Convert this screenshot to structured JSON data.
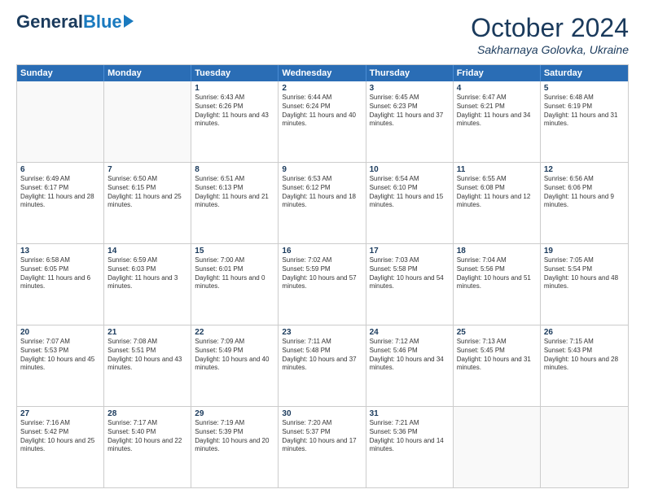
{
  "header": {
    "logo_general": "General",
    "logo_blue": "Blue",
    "month_title": "October 2024",
    "location": "Sakharnaya Golovka, Ukraine"
  },
  "days_of_week": [
    "Sunday",
    "Monday",
    "Tuesday",
    "Wednesday",
    "Thursday",
    "Friday",
    "Saturday"
  ],
  "weeks": [
    [
      {
        "day": "",
        "empty": true
      },
      {
        "day": "",
        "empty": true
      },
      {
        "day": "1",
        "sunrise": "Sunrise: 6:43 AM",
        "sunset": "Sunset: 6:26 PM",
        "daylight": "Daylight: 11 hours and 43 minutes."
      },
      {
        "day": "2",
        "sunrise": "Sunrise: 6:44 AM",
        "sunset": "Sunset: 6:24 PM",
        "daylight": "Daylight: 11 hours and 40 minutes."
      },
      {
        "day": "3",
        "sunrise": "Sunrise: 6:45 AM",
        "sunset": "Sunset: 6:23 PM",
        "daylight": "Daylight: 11 hours and 37 minutes."
      },
      {
        "day": "4",
        "sunrise": "Sunrise: 6:47 AM",
        "sunset": "Sunset: 6:21 PM",
        "daylight": "Daylight: 11 hours and 34 minutes."
      },
      {
        "day": "5",
        "sunrise": "Sunrise: 6:48 AM",
        "sunset": "Sunset: 6:19 PM",
        "daylight": "Daylight: 11 hours and 31 minutes."
      }
    ],
    [
      {
        "day": "6",
        "sunrise": "Sunrise: 6:49 AM",
        "sunset": "Sunset: 6:17 PM",
        "daylight": "Daylight: 11 hours and 28 minutes."
      },
      {
        "day": "7",
        "sunrise": "Sunrise: 6:50 AM",
        "sunset": "Sunset: 6:15 PM",
        "daylight": "Daylight: 11 hours and 25 minutes."
      },
      {
        "day": "8",
        "sunrise": "Sunrise: 6:51 AM",
        "sunset": "Sunset: 6:13 PM",
        "daylight": "Daylight: 11 hours and 21 minutes."
      },
      {
        "day": "9",
        "sunrise": "Sunrise: 6:53 AM",
        "sunset": "Sunset: 6:12 PM",
        "daylight": "Daylight: 11 hours and 18 minutes."
      },
      {
        "day": "10",
        "sunrise": "Sunrise: 6:54 AM",
        "sunset": "Sunset: 6:10 PM",
        "daylight": "Daylight: 11 hours and 15 minutes."
      },
      {
        "day": "11",
        "sunrise": "Sunrise: 6:55 AM",
        "sunset": "Sunset: 6:08 PM",
        "daylight": "Daylight: 11 hours and 12 minutes."
      },
      {
        "day": "12",
        "sunrise": "Sunrise: 6:56 AM",
        "sunset": "Sunset: 6:06 PM",
        "daylight": "Daylight: 11 hours and 9 minutes."
      }
    ],
    [
      {
        "day": "13",
        "sunrise": "Sunrise: 6:58 AM",
        "sunset": "Sunset: 6:05 PM",
        "daylight": "Daylight: 11 hours and 6 minutes."
      },
      {
        "day": "14",
        "sunrise": "Sunrise: 6:59 AM",
        "sunset": "Sunset: 6:03 PM",
        "daylight": "Daylight: 11 hours and 3 minutes."
      },
      {
        "day": "15",
        "sunrise": "Sunrise: 7:00 AM",
        "sunset": "Sunset: 6:01 PM",
        "daylight": "Daylight: 11 hours and 0 minutes."
      },
      {
        "day": "16",
        "sunrise": "Sunrise: 7:02 AM",
        "sunset": "Sunset: 5:59 PM",
        "daylight": "Daylight: 10 hours and 57 minutes."
      },
      {
        "day": "17",
        "sunrise": "Sunrise: 7:03 AM",
        "sunset": "Sunset: 5:58 PM",
        "daylight": "Daylight: 10 hours and 54 minutes."
      },
      {
        "day": "18",
        "sunrise": "Sunrise: 7:04 AM",
        "sunset": "Sunset: 5:56 PM",
        "daylight": "Daylight: 10 hours and 51 minutes."
      },
      {
        "day": "19",
        "sunrise": "Sunrise: 7:05 AM",
        "sunset": "Sunset: 5:54 PM",
        "daylight": "Daylight: 10 hours and 48 minutes."
      }
    ],
    [
      {
        "day": "20",
        "sunrise": "Sunrise: 7:07 AM",
        "sunset": "Sunset: 5:53 PM",
        "daylight": "Daylight: 10 hours and 45 minutes."
      },
      {
        "day": "21",
        "sunrise": "Sunrise: 7:08 AM",
        "sunset": "Sunset: 5:51 PM",
        "daylight": "Daylight: 10 hours and 43 minutes."
      },
      {
        "day": "22",
        "sunrise": "Sunrise: 7:09 AM",
        "sunset": "Sunset: 5:49 PM",
        "daylight": "Daylight: 10 hours and 40 minutes."
      },
      {
        "day": "23",
        "sunrise": "Sunrise: 7:11 AM",
        "sunset": "Sunset: 5:48 PM",
        "daylight": "Daylight: 10 hours and 37 minutes."
      },
      {
        "day": "24",
        "sunrise": "Sunrise: 7:12 AM",
        "sunset": "Sunset: 5:46 PM",
        "daylight": "Daylight: 10 hours and 34 minutes."
      },
      {
        "day": "25",
        "sunrise": "Sunrise: 7:13 AM",
        "sunset": "Sunset: 5:45 PM",
        "daylight": "Daylight: 10 hours and 31 minutes."
      },
      {
        "day": "26",
        "sunrise": "Sunrise: 7:15 AM",
        "sunset": "Sunset: 5:43 PM",
        "daylight": "Daylight: 10 hours and 28 minutes."
      }
    ],
    [
      {
        "day": "27",
        "sunrise": "Sunrise: 7:16 AM",
        "sunset": "Sunset: 5:42 PM",
        "daylight": "Daylight: 10 hours and 25 minutes."
      },
      {
        "day": "28",
        "sunrise": "Sunrise: 7:17 AM",
        "sunset": "Sunset: 5:40 PM",
        "daylight": "Daylight: 10 hours and 22 minutes."
      },
      {
        "day": "29",
        "sunrise": "Sunrise: 7:19 AM",
        "sunset": "Sunset: 5:39 PM",
        "daylight": "Daylight: 10 hours and 20 minutes."
      },
      {
        "day": "30",
        "sunrise": "Sunrise: 7:20 AM",
        "sunset": "Sunset: 5:37 PM",
        "daylight": "Daylight: 10 hours and 17 minutes."
      },
      {
        "day": "31",
        "sunrise": "Sunrise: 7:21 AM",
        "sunset": "Sunset: 5:36 PM",
        "daylight": "Daylight: 10 hours and 14 minutes."
      },
      {
        "day": "",
        "empty": true
      },
      {
        "day": "",
        "empty": true
      }
    ]
  ]
}
